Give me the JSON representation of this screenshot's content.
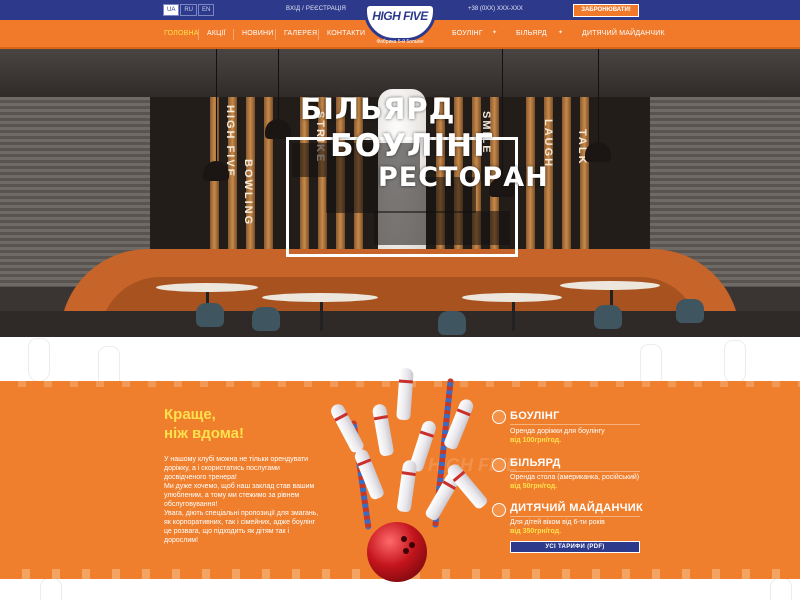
{
  "topbar": {
    "languages": [
      "UA",
      "RU",
      "EN"
    ],
    "login_text": "ВХІД / РЕЄСТРАЦІЯ",
    "phone": "+38 (0XX) XXX-XXX",
    "book_button": "ЗАБРОНЮВАТИ!"
  },
  "logo": {
    "name": "HIGH FIVE",
    "subtitle": "Фабрика 5-й 5ольме"
  },
  "nav": {
    "items": [
      "ГОЛОВНА",
      "АКЦІЇ",
      "НОВИНИ",
      "ГАЛЕРЕЯ",
      "КОНТАКТИ",
      "БОУЛІНГ",
      "БІЛЬЯРД",
      "ДИТЯЧИЙ МАЙДАНЧИК"
    ],
    "active_index": 0
  },
  "hero": {
    "line1": "БІЛЬЯРД",
    "line2": "БОУЛІНГ",
    "line3": "РЕСТОРАН",
    "slat_words": [
      "HIGH FIVE",
      "BOWLING",
      "STRIKE",
      "SMILE",
      "LAUGH",
      "TALK"
    ]
  },
  "intro": {
    "headline_line1": "Краще,",
    "headline_line2": "ніж вдома!",
    "paragraphs": [
      "У нашому клубі можна не тільки орендувати доріжку, а і скористатись послугами досвідченого тренера!",
      "Ми дуже хочемо, щоб наш заклад став вашим улюбленим, а тому ми стежимо за рівнем обслуговування!",
      "Увага, діють спеціальні пропозиції для змагань, як корпоративних, так і сімейних, адже боулінг це розвага, що підходить як дітям так і дорослим!"
    ]
  },
  "services": [
    {
      "icon": "bowling-pin-icon",
      "title": "БОУЛІНГ",
      "desc": "Оренда доріжки для боулінгу",
      "price": "від 100грн/год."
    },
    {
      "icon": "billiard-triangle-icon",
      "title": "БІЛЬЯРД",
      "desc": "Оренда стола (американка, російський)",
      "price": "від 50грн/год."
    },
    {
      "icon": "teddy-bear-icon",
      "title": "ДИТЯЧИЙ МАЙДАНЧИК",
      "desc": "Для дітей віком від 6-ти років",
      "price": "від 350грн/год."
    }
  ],
  "tariffs_button": "УСІ ТАРИФИ (PDF)",
  "colors": {
    "primary_blue": "#2d3a8c",
    "accent_orange": "#ef7f2d",
    "highlight_yellow": "#ffe14d"
  }
}
